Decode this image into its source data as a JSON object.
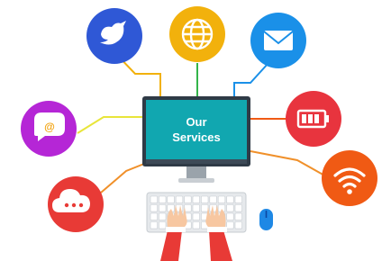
{
  "monitor": {
    "title_line1": "Our",
    "title_line2": "Services"
  },
  "icons": {
    "twitter": {
      "name": "bird-icon",
      "color": "#2f58d6"
    },
    "globe": {
      "name": "globe-icon",
      "color": "#f2b10c"
    },
    "mail": {
      "name": "mail-icon",
      "color": "#1a90e8"
    },
    "chat": {
      "name": "at-chat-icon",
      "color": "#b526d6"
    },
    "battery": {
      "name": "battery-icon",
      "color": "#e8343e"
    },
    "cloud": {
      "name": "cloud-icon",
      "color": "#e83a36"
    },
    "wifi": {
      "name": "wifi-icon",
      "color": "#f05a14"
    }
  },
  "colors": {
    "screen": "#11a7b0",
    "monitor_frame": "#2f3a46",
    "mouse": "#1e88e5",
    "keyboard": "#e6e9ec",
    "sleeve": "#e83a36",
    "hand": "#f7c7a1"
  }
}
